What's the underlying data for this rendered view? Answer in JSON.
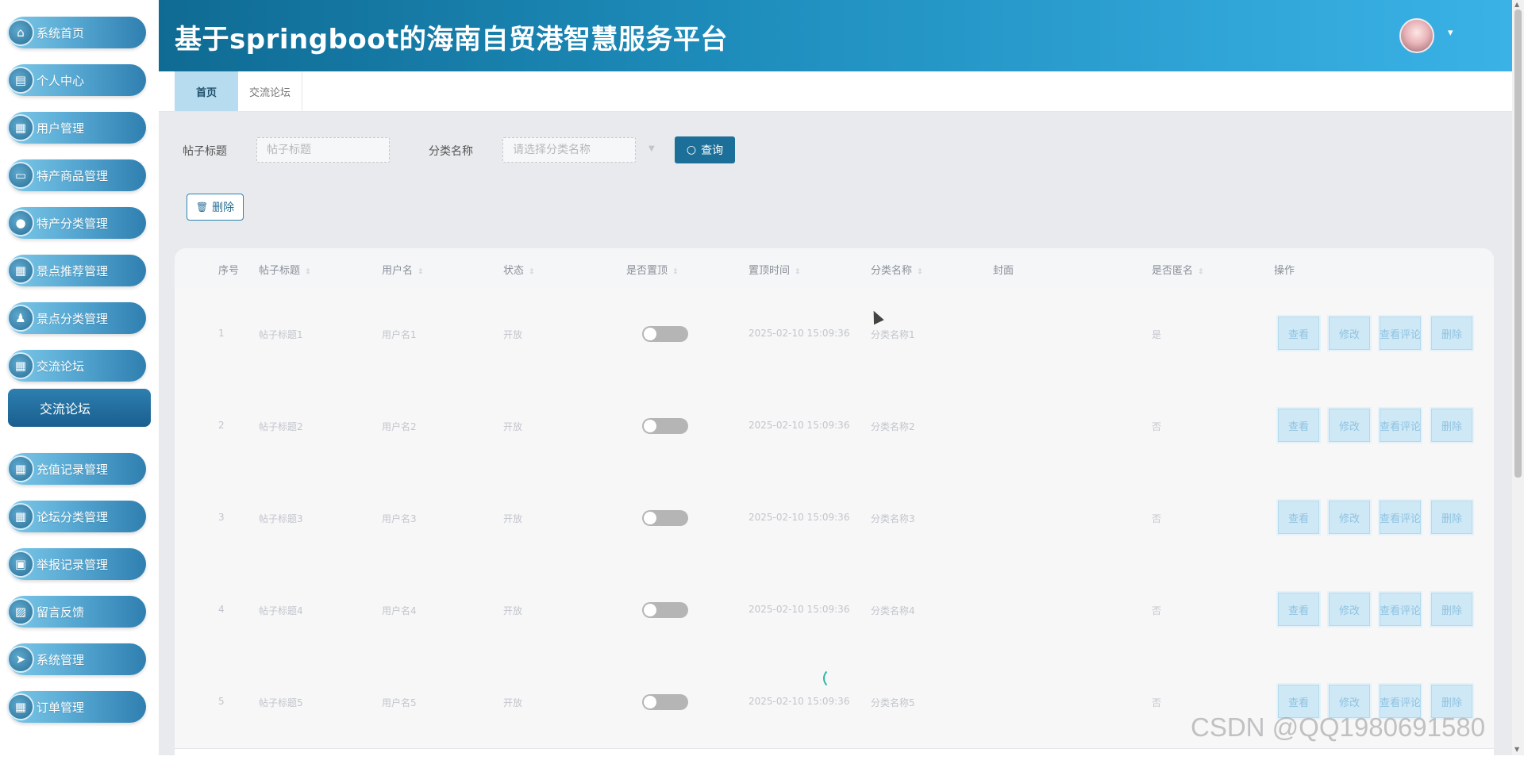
{
  "app_title": "基于springboot的海南自贸港智慧服务平台",
  "sidebar": {
    "items": [
      {
        "label": "系统首页",
        "icon": "home-icon",
        "glyph": "⌂"
      },
      {
        "label": "个人中心",
        "icon": "card-icon",
        "glyph": "▤"
      },
      {
        "label": "用户管理",
        "icon": "grid-icon",
        "glyph": "▦"
      },
      {
        "label": "特产商品管理",
        "icon": "monitor-icon",
        "glyph": "▭"
      },
      {
        "label": "特产分类管理",
        "icon": "bulb-icon",
        "glyph": "●"
      },
      {
        "label": "景点推荐管理",
        "icon": "grid-icon",
        "glyph": "▦"
      },
      {
        "label": "景点分类管理",
        "icon": "user-icon",
        "glyph": "♟"
      },
      {
        "label": "交流论坛",
        "icon": "grid-icon",
        "glyph": "▦"
      },
      {
        "label": "充值记录管理",
        "icon": "grid-icon",
        "glyph": "▦"
      },
      {
        "label": "论坛分类管理",
        "icon": "grid-icon",
        "glyph": "▦"
      },
      {
        "label": "举报记录管理",
        "icon": "briefcase-icon",
        "glyph": "▣"
      },
      {
        "label": "留言反馈",
        "icon": "clipboard-icon",
        "glyph": "▨"
      },
      {
        "label": "系统管理",
        "icon": "send-icon",
        "glyph": "➤"
      },
      {
        "label": "订单管理",
        "icon": "grid-icon",
        "glyph": "▦"
      }
    ],
    "submenu_active": "交流论坛"
  },
  "header": {
    "avatar_icon": "avatar-icon",
    "caret": "▾"
  },
  "tabs": [
    {
      "label": "首页",
      "active": true
    },
    {
      "label": "交流论坛",
      "active": false
    }
  ],
  "search": {
    "title_label": "帖子标题",
    "title_placeholder": "帖子标题",
    "category_label": "分类名称",
    "category_placeholder": "请选择分类名称",
    "query_label": "查询"
  },
  "toolbar": {
    "delete_label": "删除"
  },
  "table": {
    "columns": [
      "序号",
      "帖子标题",
      "用户名",
      "状态",
      "是否置顶",
      "置顶时间",
      "分类名称",
      "封面",
      "是否匿名",
      "操作"
    ],
    "rows": [
      {
        "index": "1",
        "title": "帖子标题1",
        "username": "用户名1",
        "status": "开放",
        "pinned": false,
        "pin_time": "2025-02-10 15:09:36",
        "category": "分类名称1",
        "anonymous": "是"
      },
      {
        "index": "2",
        "title": "帖子标题2",
        "username": "用户名2",
        "status": "开放",
        "pinned": false,
        "pin_time": "2025-02-10 15:09:36",
        "category": "分类名称2",
        "anonymous": "否"
      },
      {
        "index": "3",
        "title": "帖子标题3",
        "username": "用户名3",
        "status": "开放",
        "pinned": false,
        "pin_time": "2025-02-10 15:09:36",
        "category": "分类名称3",
        "anonymous": "否"
      },
      {
        "index": "4",
        "title": "帖子标题4",
        "username": "用户名4",
        "status": "开放",
        "pinned": false,
        "pin_time": "2025-02-10 15:09:36",
        "category": "分类名称4",
        "anonymous": "否"
      },
      {
        "index": "5",
        "title": "帖子标题5",
        "username": "用户名5",
        "status": "开放",
        "pinned": false,
        "pin_time": "2025-02-10 15:09:36",
        "category": "分类名称5",
        "anonymous": "否"
      }
    ],
    "actions": [
      "查看",
      "修改",
      "查看评论",
      "删除"
    ]
  },
  "watermark": "CSDN @QQ1980691580",
  "colors": {
    "header_start": "#0f6b93",
    "header_end": "#3ab2e6",
    "accent": "#1b6f98",
    "menu_gradient_end": "#2f7fb0"
  }
}
